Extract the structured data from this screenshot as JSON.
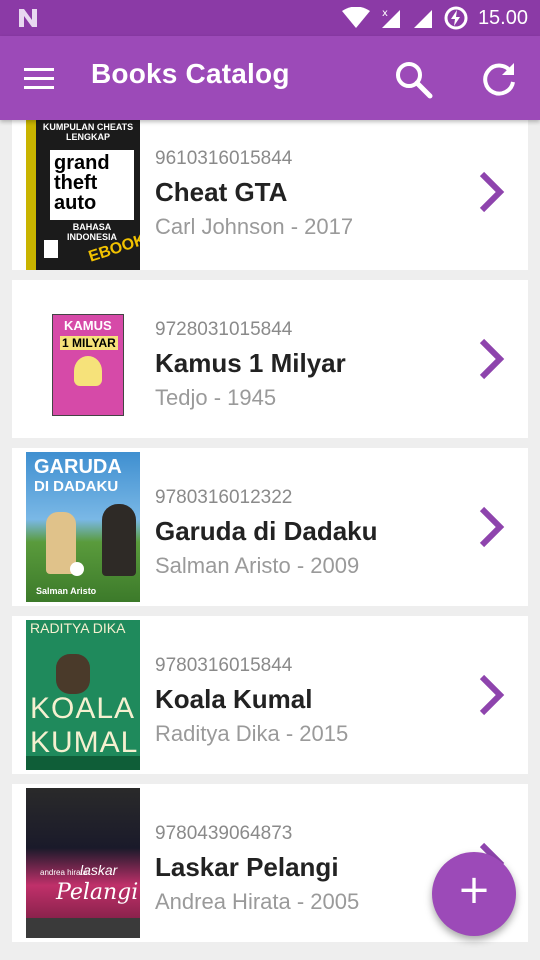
{
  "status": {
    "time": "15.00"
  },
  "appbar": {
    "title": "Books Catalog"
  },
  "books": [
    {
      "isbn": "9610316015844",
      "title": "Cheat GTA",
      "meta": "Carl Johnson - 2017"
    },
    {
      "isbn": "9728031015844",
      "title": "Kamus 1 Milyar",
      "meta": "Tedjo - 1945"
    },
    {
      "isbn": "9780316012322",
      "title": "Garuda di Dadaku",
      "meta": "Salman Aristo - 2009"
    },
    {
      "isbn": "9780316015844",
      "title": "Koala Kumal",
      "meta": "Raditya Dika - 2015"
    },
    {
      "isbn": "9780439064873",
      "title": "Laskar Pelangi",
      "meta": "Andrea Hirata - 2005"
    }
  ],
  "covers": {
    "gta": {
      "top": "KUMPULAN CHEATS LENGKAP",
      "logo1": "grand",
      "logo2": "theft",
      "logo3": "auto",
      "sub": "BAHASA INDONESIA",
      "badge": "EBOOK"
    },
    "kamus": {
      "top": "KAMUS",
      "sub": "1 MILYAR"
    },
    "garuda": {
      "title1": "GARUDA",
      "title2": "DI DADAKU",
      "author": "Salman Aristo"
    },
    "koala": {
      "author": "RADITYA DIKA",
      "title1": "KOALA",
      "title2": "KUMAL"
    },
    "laskar": {
      "title1": "laskar",
      "title2": "Pelangi",
      "author": "andrea hirata"
    }
  },
  "fab": {
    "label": "+"
  },
  "colors": {
    "primary": "#9c4ab8",
    "status": "#8b3aa6",
    "accent": "#8e44ad"
  }
}
